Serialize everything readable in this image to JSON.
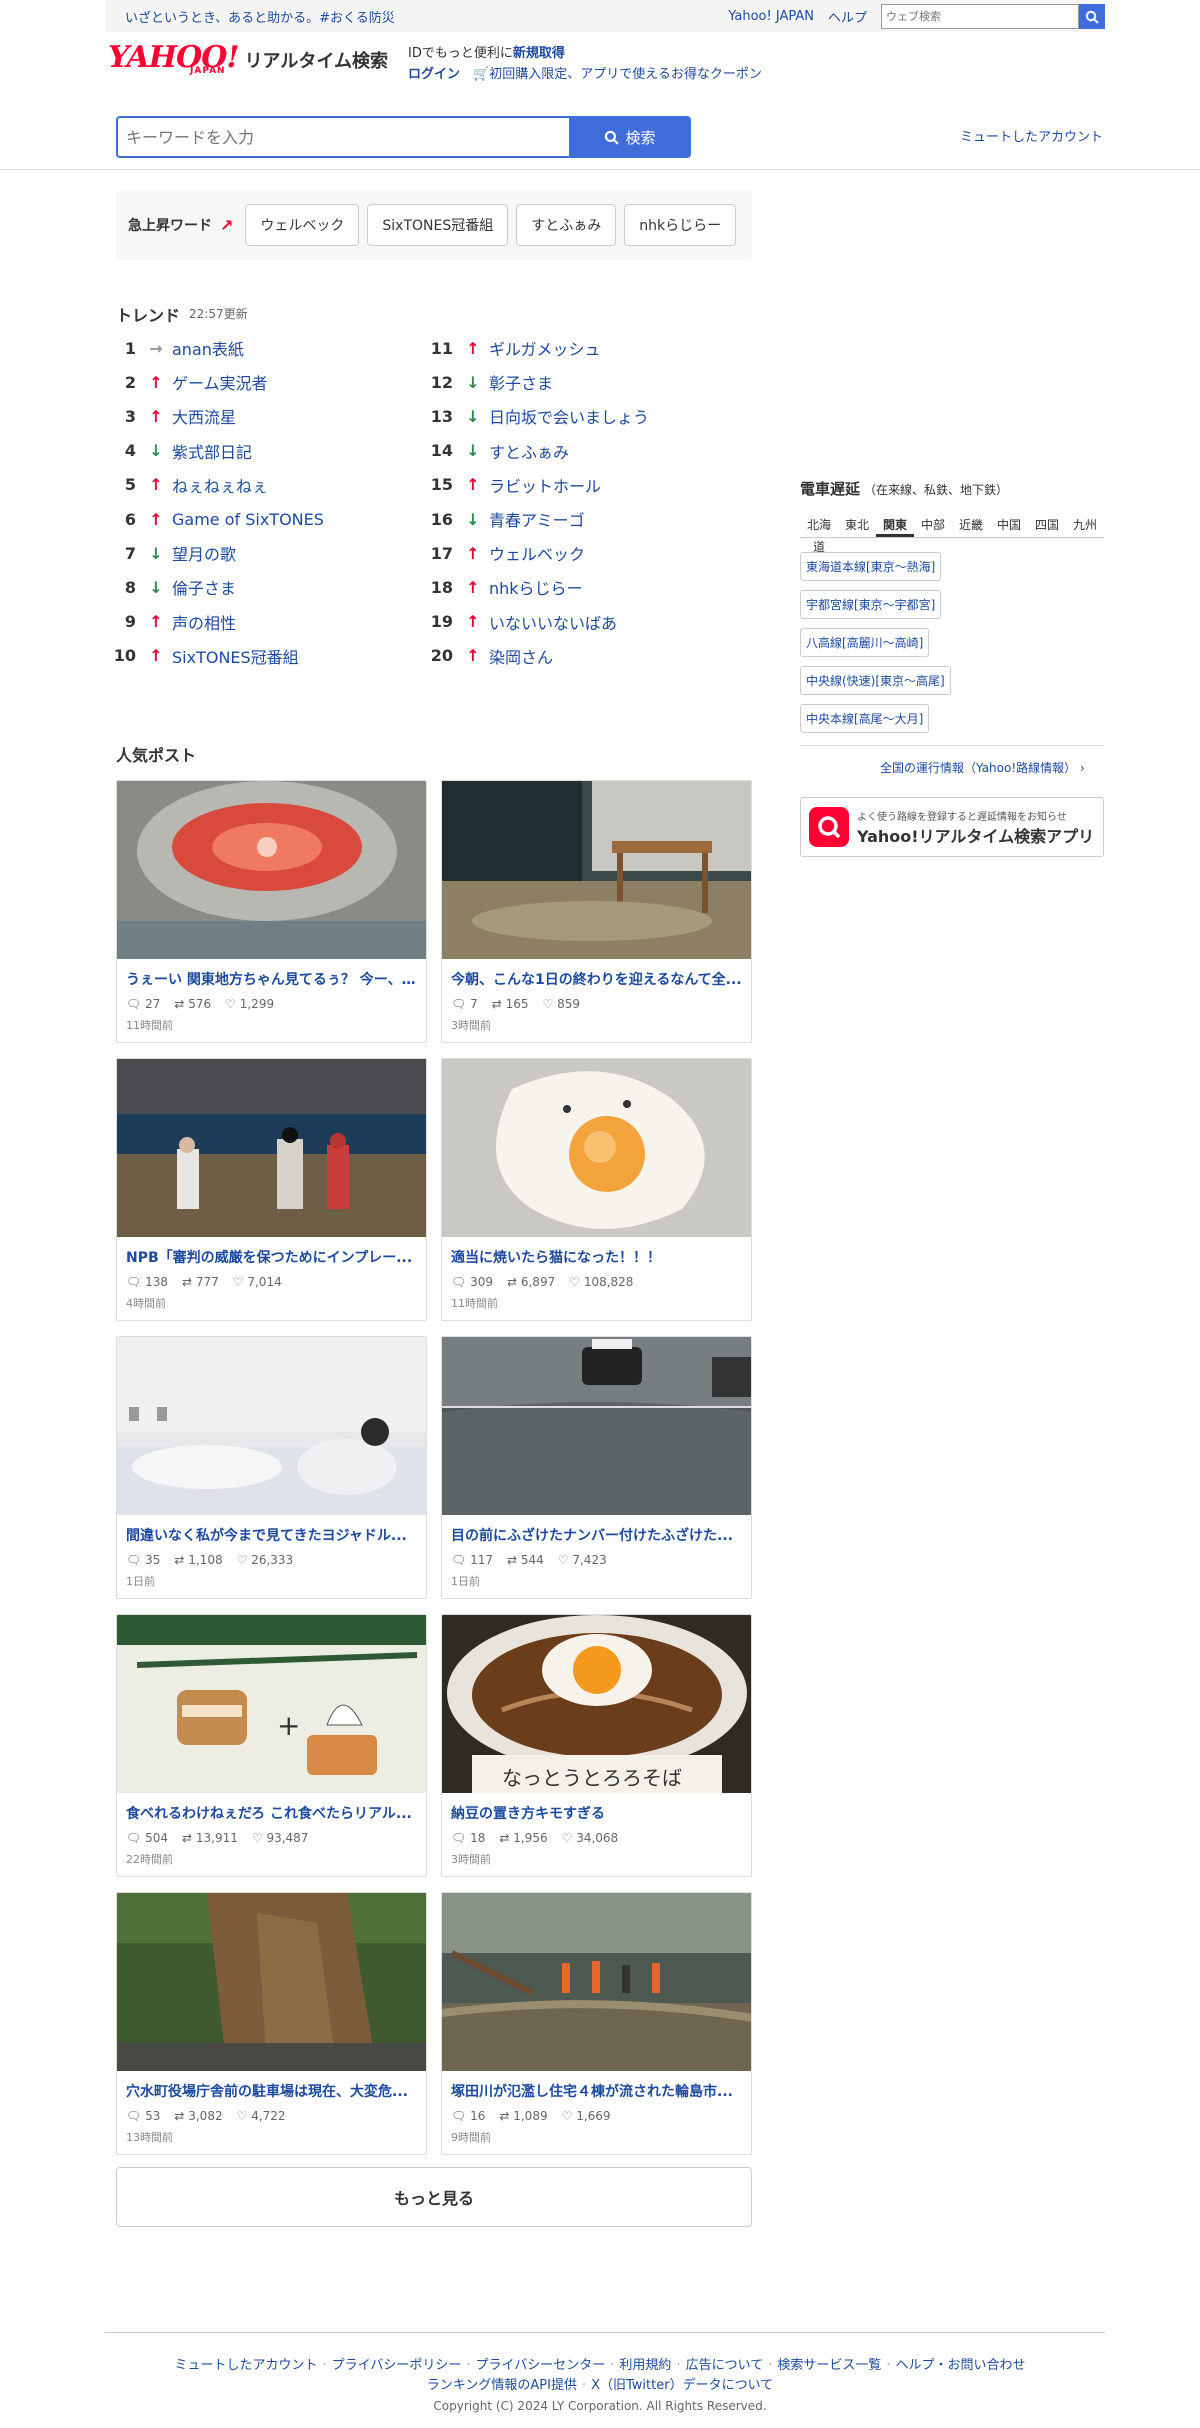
{
  "topbar": {
    "notice": "いざというとき、あると助かる。#おくる防災",
    "links": [
      "Yahoo! JAPAN",
      "ヘルプ"
    ],
    "web_search_placeholder": "ウェブ検索"
  },
  "header": {
    "logo_yahoo": "YAHOO!",
    "logo_japan": "JAPAN",
    "service_name": "リアルタイム検索",
    "promo_prefix": "IDでもっと便利に",
    "signup": "新規取得",
    "login": "ログイン",
    "coupon_text": "初回購入限定、アプリで使えるお得なクーポン"
  },
  "search": {
    "placeholder": "キーワードを入力",
    "button_label": "検索",
    "muted_accounts": "ミュートしたアカウント"
  },
  "rising": {
    "label": "急上昇ワード",
    "words": [
      "ウェルベック",
      "SixTONES冠番組",
      "すとふぁみ",
      "nhkらじらー"
    ]
  },
  "trend": {
    "title": "トレンド",
    "updated": "22:57更新",
    "left": [
      {
        "rank": "1",
        "dir": "flat",
        "text": "anan表紙"
      },
      {
        "rank": "2",
        "dir": "up",
        "text": "ゲーム実況者"
      },
      {
        "rank": "3",
        "dir": "up",
        "text": "大西流星"
      },
      {
        "rank": "4",
        "dir": "down",
        "text": "紫式部日記"
      },
      {
        "rank": "5",
        "dir": "up",
        "text": "ねぇねぇねぇ"
      },
      {
        "rank": "6",
        "dir": "up",
        "text": "Game of SixTONES"
      },
      {
        "rank": "7",
        "dir": "down",
        "text": "望月の歌"
      },
      {
        "rank": "8",
        "dir": "down",
        "text": "倫子さま"
      },
      {
        "rank": "9",
        "dir": "up",
        "text": "声の相性"
      },
      {
        "rank": "10",
        "dir": "up",
        "text": "SixTONES冠番組"
      }
    ],
    "right": [
      {
        "rank": "11",
        "dir": "up",
        "text": "ギルガメッシュ"
      },
      {
        "rank": "12",
        "dir": "down",
        "text": "彰子さま"
      },
      {
        "rank": "13",
        "dir": "down",
        "text": "日向坂で会いましょう"
      },
      {
        "rank": "14",
        "dir": "down",
        "text": "すとふぁみ"
      },
      {
        "rank": "15",
        "dir": "up",
        "text": "ラビットホール"
      },
      {
        "rank": "16",
        "dir": "down",
        "text": "青春アミーゴ"
      },
      {
        "rank": "17",
        "dir": "up",
        "text": "ウェルベック"
      },
      {
        "rank": "18",
        "dir": "up",
        "text": "nhkらじらー"
      },
      {
        "rank": "19",
        "dir": "up",
        "text": "いないいないばあ"
      },
      {
        "rank": "20",
        "dir": "up",
        "text": "染岡さん"
      }
    ]
  },
  "popular": {
    "title": "人気ポスト",
    "posts": [
      {
        "title": "うぇーい 関東地方ちゃん見てるぅ？ 今ー、...",
        "replies": "27",
        "reposts": "576",
        "likes": "1,299",
        "ago": "11時間前",
        "img": "heater"
      },
      {
        "title": "今朝、こんな1日の終わりを迎えるなんて全...",
        "replies": "7",
        "reposts": "165",
        "likes": "859",
        "ago": "3時間前",
        "img": "flood-room"
      },
      {
        "title": "NPB「審判の威厳を保つためにインプレー...",
        "replies": "138",
        "reposts": "777",
        "likes": "7,014",
        "ago": "4時間前",
        "img": "baseball"
      },
      {
        "title": "適当に焼いたら猫になった！！！",
        "replies": "309",
        "reposts": "6,897",
        "likes": "108,828",
        "ago": "11時間前",
        "img": "egg"
      },
      {
        "title": "間違いなく私が今まで見てきたヨジャドル...",
        "replies": "35",
        "reposts": "1,108",
        "likes": "26,333",
        "ago": "1日前",
        "img": "bed"
      },
      {
        "title": "目の前にふざけたナンバー付けたふざけた...",
        "replies": "117",
        "reposts": "544",
        "likes": "7,423",
        "ago": "1日前",
        "img": "car"
      },
      {
        "title": "食べれるわけねぇだろ これ食べたらリアル...",
        "replies": "504",
        "reposts": "13,911",
        "likes": "93,487",
        "ago": "22時間前",
        "img": "menu"
      },
      {
        "title": "納豆の置き方キモすぎる",
        "replies": "18",
        "reposts": "1,956",
        "likes": "34,068",
        "ago": "3時間前",
        "img": "soba"
      },
      {
        "title": "穴水町役場庁舎前の駐車場は現在、大変危...",
        "replies": "53",
        "reposts": "3,082",
        "likes": "4,722",
        "ago": "13時間前",
        "img": "landslide"
      },
      {
        "title": "塚田川が氾濫し住宅４棟が流された輪島市...",
        "replies": "16",
        "reposts": "1,089",
        "likes": "1,669",
        "ago": "9時間前",
        "img": "river"
      }
    ],
    "more": "もっと見る"
  },
  "train": {
    "title": "電車遅延",
    "subtitle": "（在来線、私鉄、地下鉄）",
    "tabs": [
      "北海道",
      "東北",
      "関東",
      "中部",
      "近畿",
      "中国",
      "四国",
      "九州"
    ],
    "active_tab": "関東",
    "lines": [
      "東海道本線[東京〜熱海]",
      "宇都宮線[東京〜宇都宮]",
      "八高線[高麗川〜高崎]",
      "中央線(快速)[東京〜高尾]",
      "中央本線[高尾〜大月]"
    ],
    "nationwide": "全国の運行情報（Yahoo!路線情報）",
    "app_small": "よく使う路線を登録すると遅延情報をお知らせ",
    "app_name": "Yahoo!リアルタイム検索アプリ"
  },
  "footer": {
    "links1": [
      "ミュートしたアカウント",
      "プライバシーポリシー",
      "プライバシーセンター",
      "利用規約",
      "広告について",
      "検索サービス一覧",
      "ヘルプ・お問い合わせ"
    ],
    "links2": [
      "ランキング情報のAPI提供",
      "X（旧Twitter）データについて"
    ],
    "copyright": "Copyright (C) 2024 LY Corporation. All Rights Reserved."
  },
  "colors": {
    "accent": "#3f6edb",
    "link": "#1d4a9e",
    "brand": "#ff0033",
    "up": "#e60033",
    "down": "#2b8a4a"
  }
}
